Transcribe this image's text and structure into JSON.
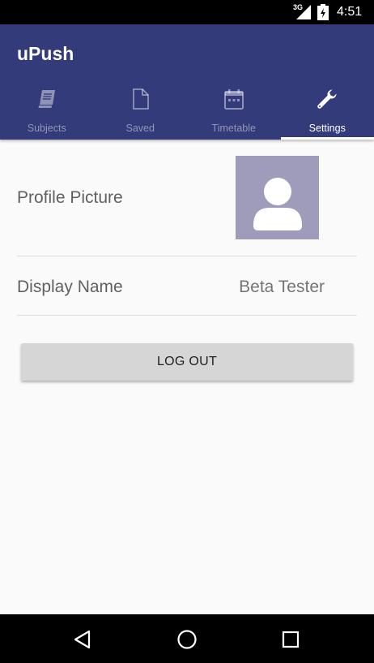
{
  "status_bar": {
    "network": "3G",
    "time": "4:51"
  },
  "app_bar": {
    "title": "uPush",
    "colors": {
      "primary": "#333b7a",
      "indicator": "#ffffff"
    }
  },
  "tabs": [
    {
      "label": "Subjects",
      "icon": "book-icon",
      "active": false
    },
    {
      "label": "Saved",
      "icon": "document-icon",
      "active": false
    },
    {
      "label": "Timetable",
      "icon": "calendar-icon",
      "active": false
    },
    {
      "label": "Settings",
      "icon": "wrench-icon",
      "active": true
    }
  ],
  "settings": {
    "profile_picture_label": "Profile Picture",
    "display_name_label": "Display Name",
    "display_name_value": "Beta Tester",
    "logout_label": "LOG OUT"
  },
  "nav_bar": {
    "buttons": [
      "back-icon",
      "home-icon",
      "recents-icon"
    ]
  }
}
